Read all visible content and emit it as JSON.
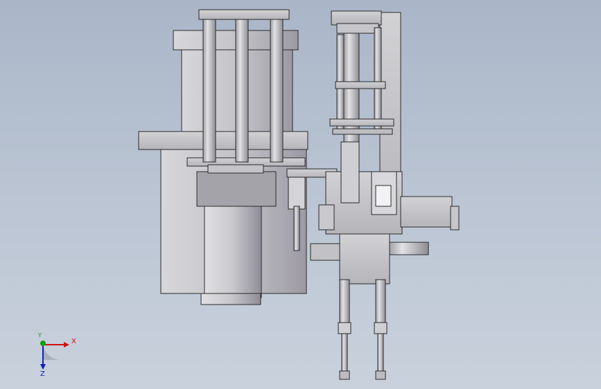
{
  "viewport": {
    "background_top": "#aab6c8",
    "background_bottom": "#c9d1dc",
    "part_fill": "#c9c9cc",
    "part_shade": "#9a99a0",
    "edge_color": "#2a2a2a"
  },
  "triad": {
    "x_label": "X",
    "y_label": "Y",
    "z_label": "Z",
    "x_color": "#d01010",
    "y_color": "#10a010",
    "z_color": "#1020c0"
  }
}
